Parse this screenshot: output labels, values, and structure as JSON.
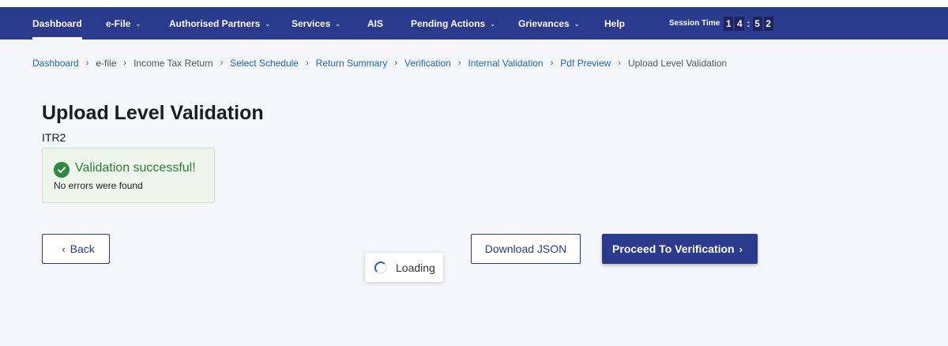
{
  "nav": {
    "items": [
      {
        "label": "Dashboard",
        "dropdown": false,
        "active": true
      },
      {
        "label": "e-File",
        "dropdown": true
      },
      {
        "label": "Authorised Partners",
        "dropdown": true
      },
      {
        "label": "Services",
        "dropdown": true
      },
      {
        "label": "AIS",
        "dropdown": false
      },
      {
        "label": "Pending Actions",
        "dropdown": true
      },
      {
        "label": "Grievances",
        "dropdown": true
      },
      {
        "label": "Help",
        "dropdown": false
      }
    ],
    "caret": "⌄",
    "session_label": "Session Time",
    "session_digits": [
      "1",
      "4",
      "5",
      "2"
    ],
    "session_colon": ":"
  },
  "breadcrumb": {
    "separator": "›",
    "items": [
      {
        "label": "Dashboard",
        "link": true
      },
      {
        "label": "e-file",
        "link": false
      },
      {
        "label": "Income Tax Return",
        "link": false
      },
      {
        "label": "Select Schedule",
        "link": true
      },
      {
        "label": "Return Summary",
        "link": true
      },
      {
        "label": "Verification",
        "link": true
      },
      {
        "label": "Internal Validation",
        "link": true
      },
      {
        "label": "Pdf Preview",
        "link": true
      },
      {
        "label": "Upload Level Validation",
        "link": false
      }
    ]
  },
  "page": {
    "title": "Upload Level Validation",
    "subtitle": "ITR2"
  },
  "validation": {
    "title": "Validation successful!",
    "message": "No errors were found",
    "icon": "check-circle-icon"
  },
  "buttons": {
    "back_label": "Back",
    "download_label": "Download JSON",
    "proceed_label": "Proceed To Verification",
    "left_chevron": "‹",
    "right_chevron": "›"
  },
  "loading": {
    "label": "Loading"
  },
  "colors": {
    "primary": "#2a3a8c",
    "link": "#1a6bb5",
    "success": "#2b8a3e",
    "background": "#f5f6f9"
  }
}
